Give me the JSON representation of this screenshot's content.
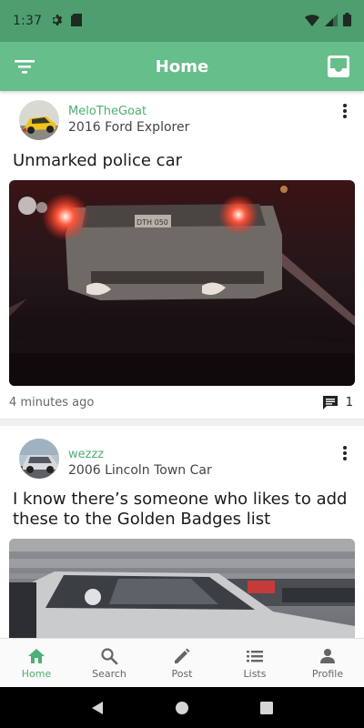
{
  "status_bar": {
    "time": "1:37"
  },
  "app_bar": {
    "title": "Home"
  },
  "posts": [
    {
      "username": "MeloTheGoat",
      "car": "2016 Ford Explorer",
      "title": "Unmarked police car",
      "timestamp": "4 minutes ago",
      "comment_count": "1",
      "plate_text": "DTH 050"
    },
    {
      "username": "wezzz",
      "car": "2006 Lincoln Town Car",
      "title": "I know there’s someone who likes to add these to the Golden Badges list"
    }
  ],
  "bottom_nav": [
    {
      "label": "Home",
      "icon": "home-icon",
      "active": true
    },
    {
      "label": "Search",
      "icon": "search-icon"
    },
    {
      "label": "Post",
      "icon": "pencil-icon"
    },
    {
      "label": "Lists",
      "icon": "list-icon"
    },
    {
      "label": "Profile",
      "icon": "person-icon"
    }
  ],
  "colors": {
    "accent": "#4caf73",
    "app_bar": "#66be8a",
    "status_bar": "#4e9e70"
  }
}
